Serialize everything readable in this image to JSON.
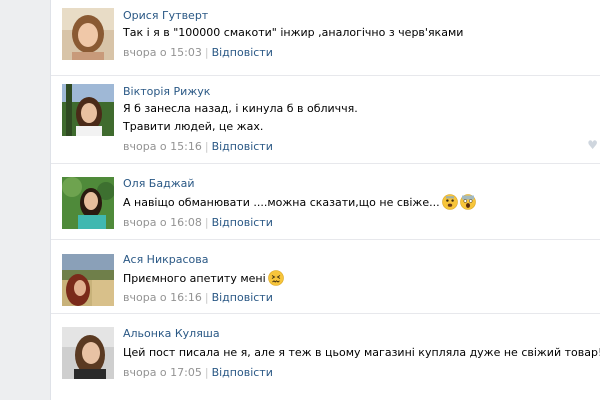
{
  "comments": [
    {
      "author": "Орися Гутверт",
      "lines": [
        "Так і я в \"100000 смакоти\" інжир ,аналогічно з черв'яками"
      ],
      "time": "вчора о 15:03",
      "reply": "Відповісти"
    },
    {
      "author": "Вікторія Рижук",
      "lines": [
        "Я б занесла назад, і кинула б в обличчя.",
        "Травити людей, це жах."
      ],
      "time": "вчора о 15:16",
      "reply": "Відповісти"
    },
    {
      "author": "Оля Баджай",
      "lines": [
        "А навіщо обманювати ....можна сказати,що не свіже..."
      ],
      "time": "вчора о 16:08",
      "reply": "Відповісти",
      "emojis": [
        "fearful-face",
        "screaming-face"
      ]
    },
    {
      "author": "Ася Никрасова",
      "lines": [
        "Приємного апетиту мені"
      ],
      "time": "вчора о 16:16",
      "reply": "Відповісти",
      "emojis": [
        "confounded-face"
      ]
    },
    {
      "author": "Альонка Куляша",
      "lines": [
        "Цей пост писала не я, але я теж в цьому магазині купляла дуже не свіжий товар!"
      ],
      "time": "вчора о 17:05",
      "reply": "Відповісти"
    }
  ],
  "colors": {
    "link": "#2a5885",
    "meta": "#939393",
    "divider": "#e7e8ec",
    "rail": "#edeef0"
  },
  "icons": {
    "like": "heart-icon"
  }
}
